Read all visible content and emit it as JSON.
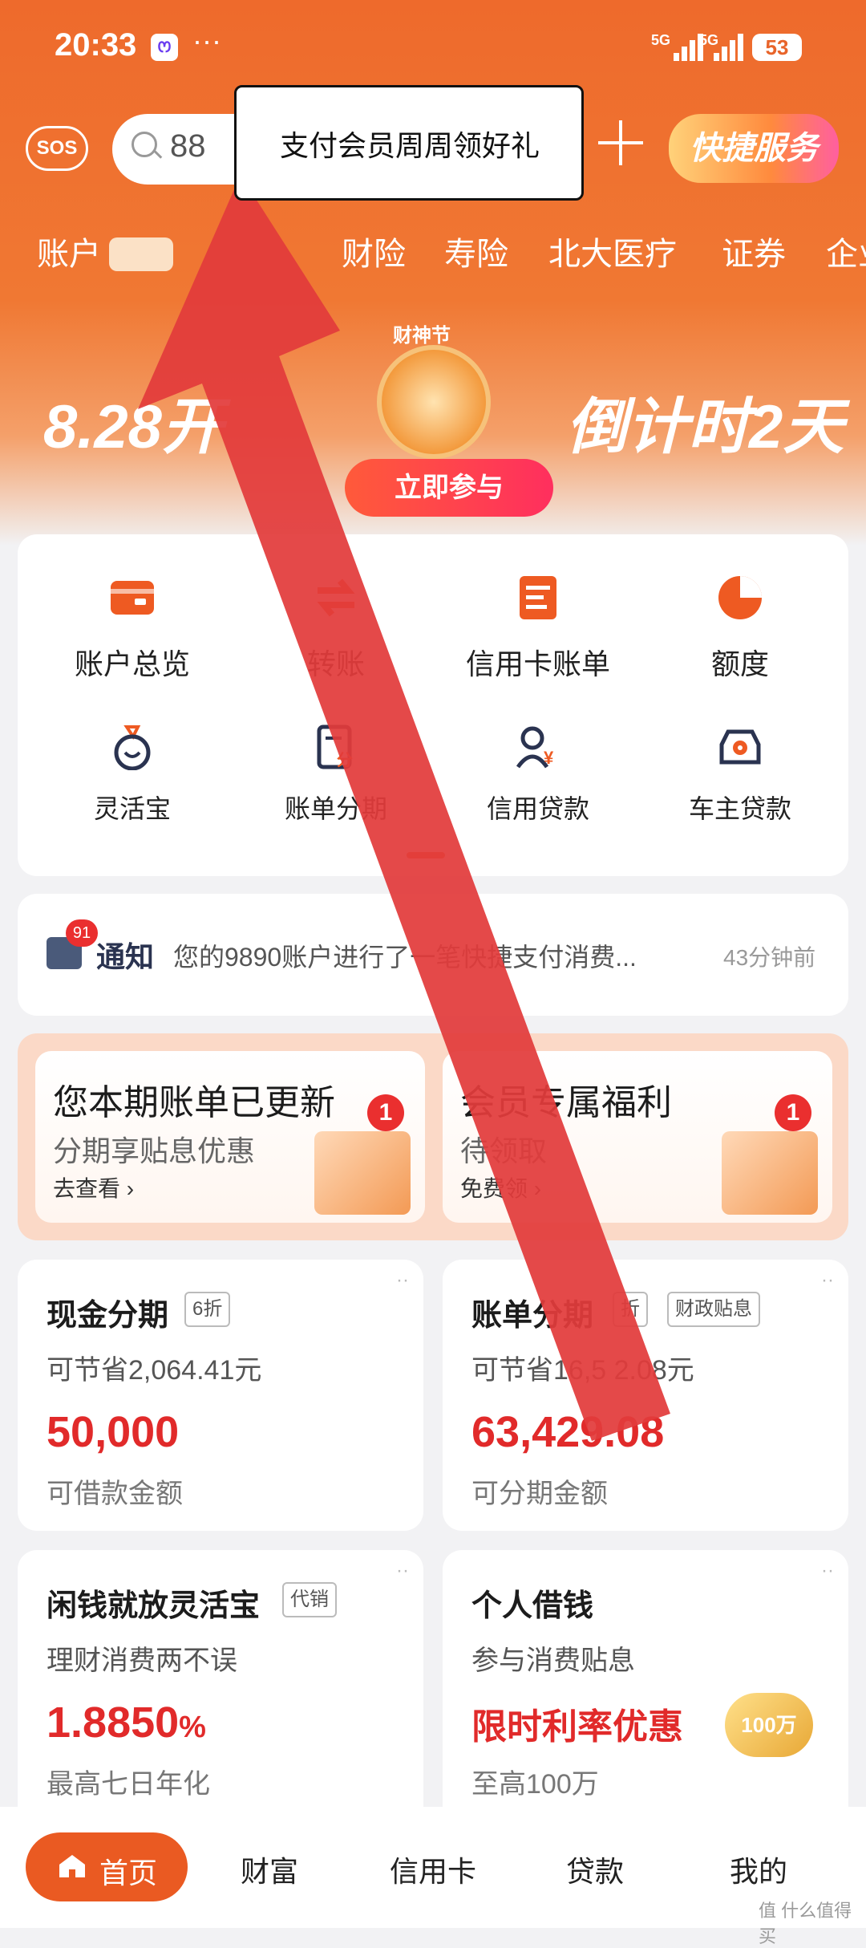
{
  "status_bar": {
    "time": "20:33",
    "app_badge": "ꯁ",
    "more": "···",
    "signal1": "5G",
    "signal2": "5G",
    "battery": "53"
  },
  "header": {
    "sos": "SOS",
    "search_value": "88",
    "quick_service": "快捷服务",
    "tabs": [
      "账户",
      "财险",
      "寿险",
      "北大医疗",
      "证券",
      "企业"
    ]
  },
  "tooltip": {
    "text": "支付会员周周领好礼"
  },
  "banner": {
    "left_text": "8.28开",
    "right_text": "倒计时2天",
    "small_text": "财神节",
    "button": "立即参与"
  },
  "grid": {
    "items": [
      {
        "label": "账户总览",
        "icon": "wallet-icon"
      },
      {
        "label": "转账",
        "icon": "transfer-icon"
      },
      {
        "label": "信用卡账单",
        "icon": "bill-icon"
      },
      {
        "label": "额度",
        "icon": "pie-icon"
      },
      {
        "label": "灵活宝",
        "icon": "moneybag-icon"
      },
      {
        "label": "账单分期",
        "icon": "installment-icon"
      },
      {
        "label": "信用贷款",
        "icon": "loan-icon"
      },
      {
        "label": "车主贷款",
        "icon": "car-icon"
      }
    ]
  },
  "notice": {
    "badge": "91",
    "title": "通知",
    "text": "您的9890账户进行了一笔快捷支付消费...",
    "time": "43分钟前"
  },
  "promos": [
    {
      "title": "您本期账单已更新",
      "subtitle": "分期享贴息优惠",
      "link": "去查看 ›",
      "badge": "1"
    },
    {
      "title": "会员专属福利",
      "subtitle": "待领取",
      "link": "免费领 ›",
      "badge": "1"
    }
  ],
  "finance": {
    "cash": {
      "title": "现金分期",
      "tag": "6折",
      "save": "可节省2,064.41元",
      "amount": "50,000",
      "label": "可借款金额",
      "more": "··"
    },
    "bill": {
      "title": "账单分期",
      "tag1": "折",
      "tag2": "财政贴息",
      "save": "可节省16,5  2.08元",
      "amount": "63,429.08",
      "label": "可分期金额",
      "more": "··"
    },
    "flex": {
      "title": "闲钱就放灵活宝",
      "tag": "代销",
      "sub": "理财消费两不误",
      "rate": "1.8850",
      "pct": "%",
      "label": "最高七日年化",
      "more": "··"
    },
    "personal": {
      "title": "个人借钱",
      "sub": "参与消费贴息",
      "promo": "限时利率优惠",
      "label": "至高100万",
      "coin": "100万",
      "more": "··"
    }
  },
  "nav": {
    "home": "首页",
    "wealth": "财富",
    "credit": "信用卡",
    "loan": "贷款",
    "mine": "我的"
  },
  "watermark": "值 什么值得买",
  "colors": {
    "brand_orange": "#ee6a2c",
    "amount_red": "#e12a2a",
    "arrow_red": "#e23b3b"
  }
}
